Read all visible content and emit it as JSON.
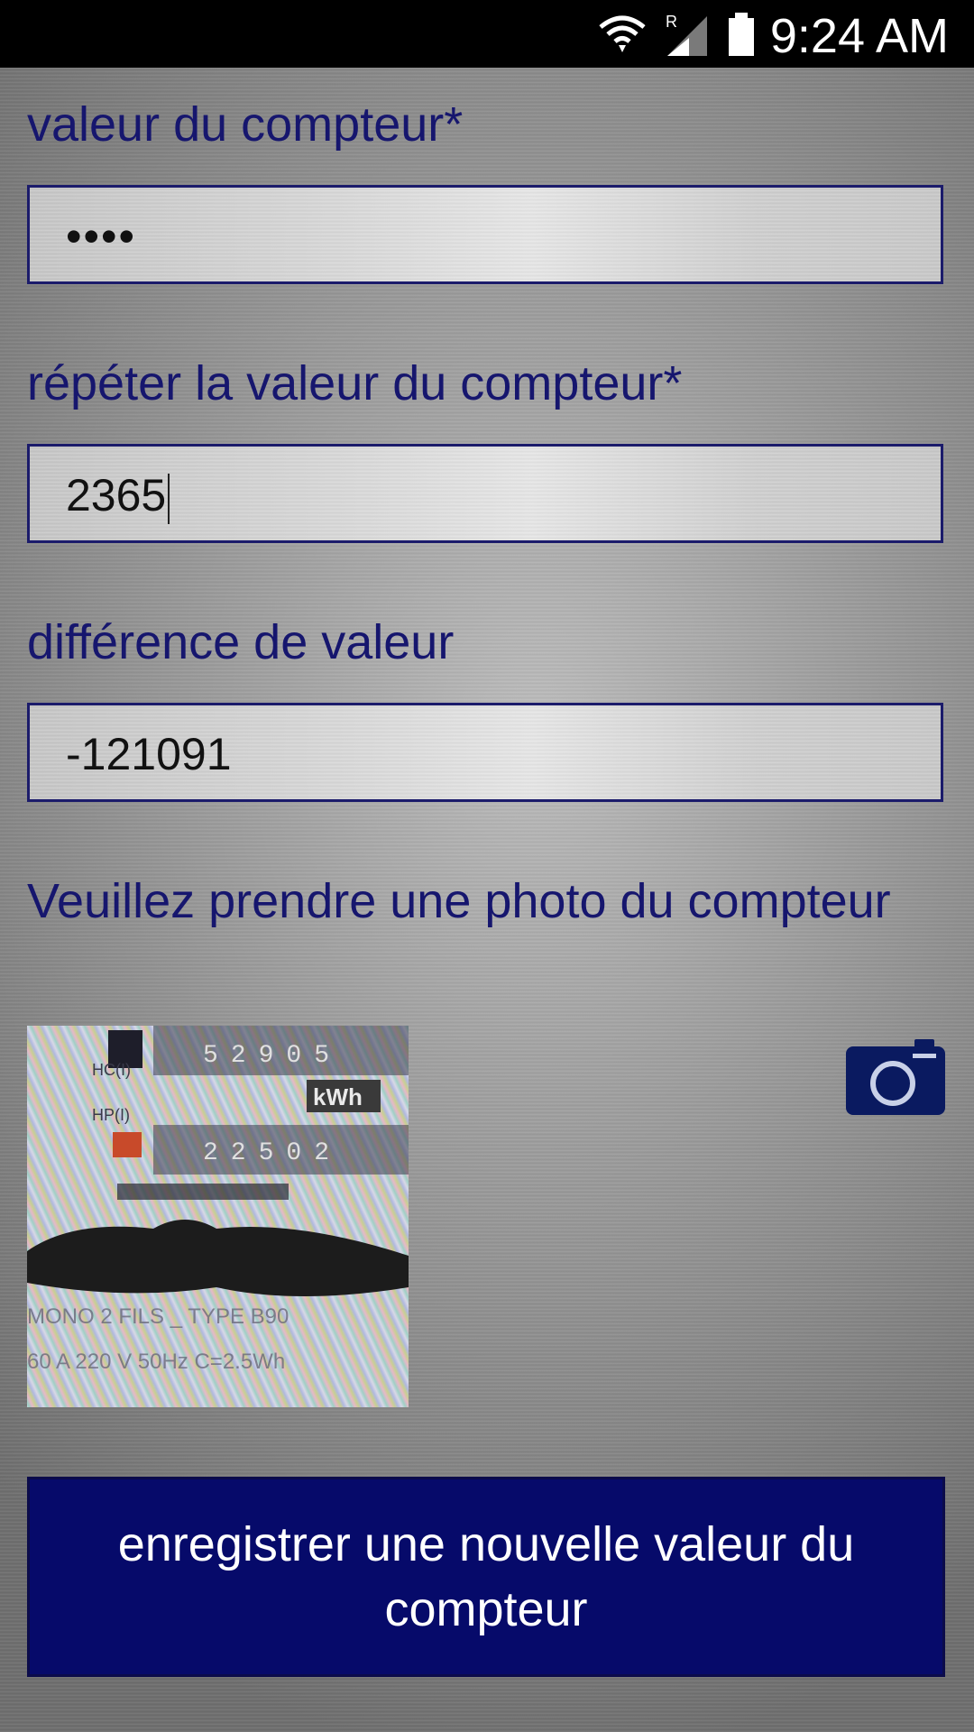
{
  "status_bar": {
    "time": "9:24 AM",
    "network_indicator": "R",
    "icons": [
      "wifi-icon",
      "signal-icon",
      "battery-icon"
    ]
  },
  "form": {
    "meter_value": {
      "label": "valeur du compteur*",
      "value": "••••"
    },
    "repeat_meter_value": {
      "label": "répéter la valeur du compteur*",
      "value": "2365"
    },
    "value_difference": {
      "label": "différence de valeur",
      "value": "-121091"
    },
    "photo_prompt": "Veuillez prendre une photo du compteur",
    "photo": {
      "top_reading": "52905",
      "unit": "kWh",
      "bottom_reading": "22502",
      "hc_label": "HC(I)",
      "hp_label": "HP(I)",
      "footer_line_1": "MONO 2 FILS _ TYPE B90",
      "footer_line_2": "60 A 220 V 50Hz C=2.5Wh"
    },
    "camera_icon": "camera-icon",
    "submit_label": "enregistrer une nouvelle valeur du compteur"
  },
  "colors": {
    "label_text": "#16166e",
    "button_bg": "#060a6a",
    "field_border": "#1b1b6b"
  }
}
